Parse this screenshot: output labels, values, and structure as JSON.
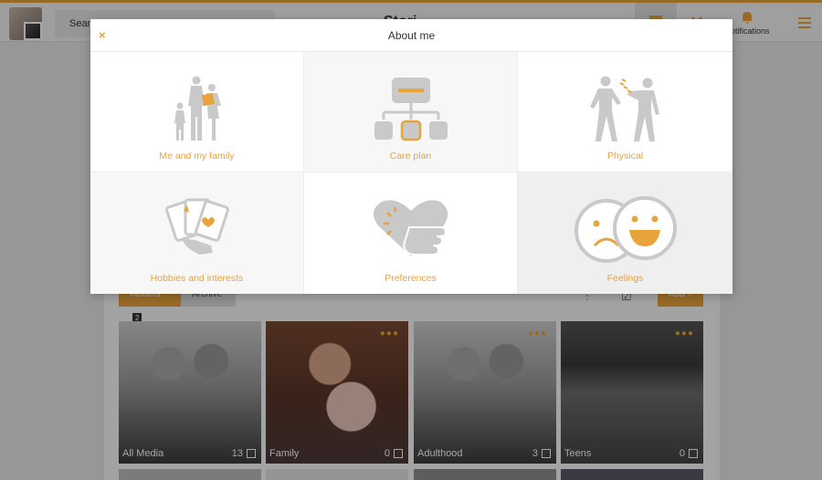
{
  "app": {
    "search_label": "Search",
    "brand": "Stori",
    "notifications_label": "Notifications"
  },
  "tabs": {
    "albums_label": "Albums",
    "albums_badge": "2",
    "archive_label": "Archive"
  },
  "toolbar": {
    "add_label": "Add +"
  },
  "albums": [
    {
      "title": "All Media",
      "count": "13"
    },
    {
      "title": "Family",
      "count": "0"
    },
    {
      "title": "Adulthood",
      "count": "3"
    },
    {
      "title": "Teens",
      "count": "0"
    }
  ],
  "modal": {
    "title": "About me",
    "close_glyph": "×",
    "items": [
      {
        "label": "Me and my family",
        "icon": "family-icon"
      },
      {
        "label": "Care plan",
        "icon": "care-plan-icon"
      },
      {
        "label": "Physical",
        "icon": "physical-icon"
      },
      {
        "label": "Hobbies and interests",
        "icon": "hobbies-icon"
      },
      {
        "label": "Preferences",
        "icon": "preferences-icon"
      },
      {
        "label": "Feelings",
        "icon": "feelings-icon"
      }
    ]
  },
  "colors": {
    "accent": "#e8a33a",
    "icon_grey": "#c9c9c9"
  }
}
